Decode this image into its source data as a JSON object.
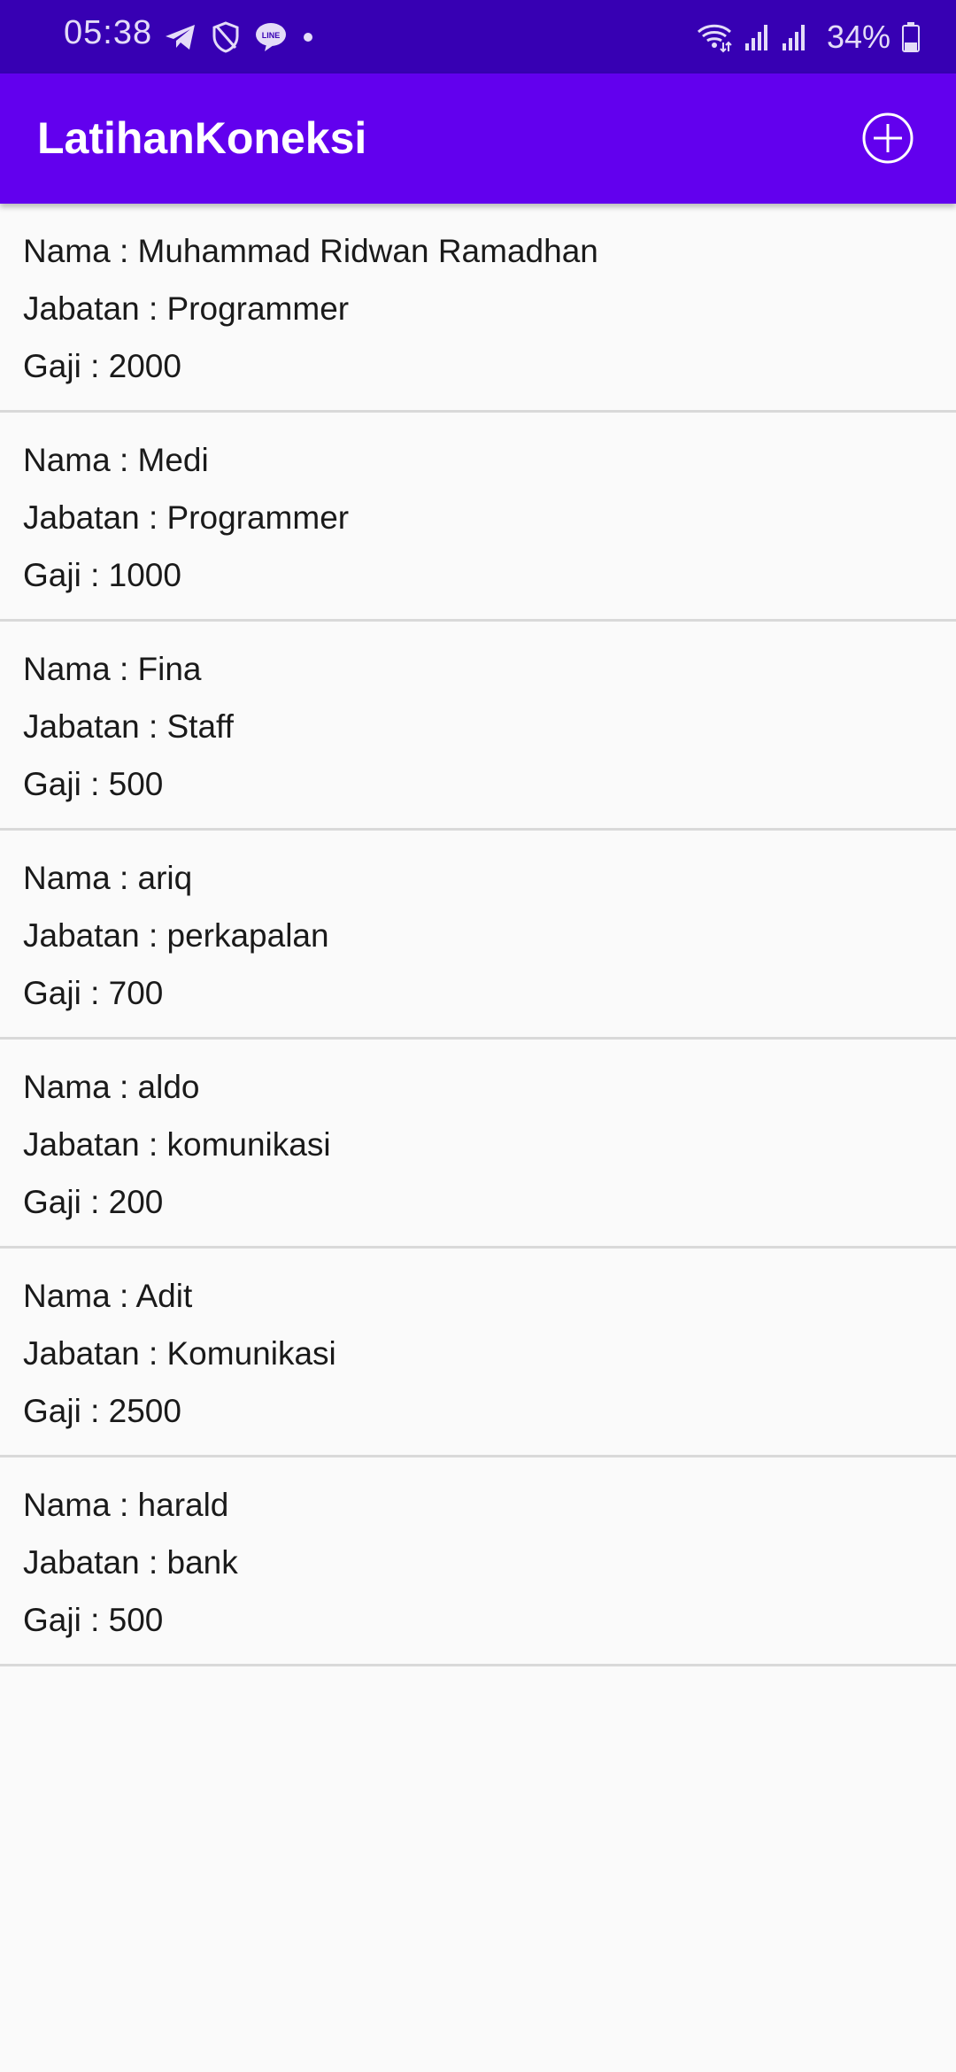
{
  "status_bar": {
    "time": "05:38",
    "icons_left": [
      "telegram-icon",
      "shield-icon",
      "line-icon",
      "dot-icon"
    ],
    "icons_right": [
      "wifi-icon",
      "signal-icon",
      "signal-icon"
    ],
    "battery_percent": "34%",
    "battery_level": 0.34
  },
  "app_bar": {
    "title": "LatihanKoneksi",
    "add_icon": "add-circle-icon"
  },
  "employees": [
    {
      "nama": "Nama : Muhammad Ridwan Ramadhan",
      "jabatan": "Jabatan : Programmer",
      "gaji": "Gaji : 2000"
    },
    {
      "nama": "Nama : Medi",
      "jabatan": "Jabatan : Programmer",
      "gaji": "Gaji : 1000"
    },
    {
      "nama": "Nama : Fina",
      "jabatan": "Jabatan : Staff",
      "gaji": "Gaji : 500"
    },
    {
      "nama": "Nama : ariq",
      "jabatan": "Jabatan : perkapalan",
      "gaji": "Gaji : 700"
    },
    {
      "nama": "Nama : aldo",
      "jabatan": "Jabatan : komunikasi",
      "gaji": "Gaji : 200"
    },
    {
      "nama": "Nama : Adit",
      "jabatan": "Jabatan : Komunikasi",
      "gaji": "Gaji : 2500"
    },
    {
      "nama": "Nama : harald",
      "jabatan": "Jabatan : bank",
      "gaji": "Gaji : 500"
    }
  ],
  "colors": {
    "status_bar": "#3700b3",
    "app_bar": "#6200ee",
    "background": "#fafafa",
    "divider": "#d9d9d9"
  }
}
